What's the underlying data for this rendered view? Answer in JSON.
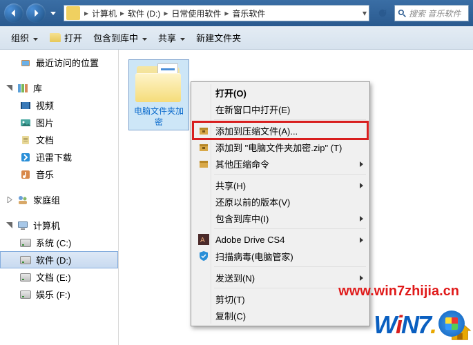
{
  "breadcrumb": [
    "计算机",
    "软件 (D:)",
    "日常使用软件",
    "音乐软件"
  ],
  "search": {
    "placeholder": "搜索 音乐软件"
  },
  "toolbar": {
    "organize": "组织",
    "open": "打开",
    "include": "包含到库中",
    "share": "共享",
    "newfolder": "新建文件夹"
  },
  "sidebar": {
    "recent": "最近访问的位置",
    "libraries": "库",
    "videos": "视频",
    "pictures": "图片",
    "documents": "文档",
    "xunlei": "迅雷下载",
    "music": "音乐",
    "homegroup": "家庭组",
    "computer": "计算机",
    "drive_c": "系统 (C:)",
    "drive_d": "软件 (D:)",
    "drive_e": "文档 (E:)",
    "drive_f": "娱乐 (F:)"
  },
  "content": {
    "folder1": "电脑文件夹加密"
  },
  "context_menu": {
    "open": "打开(O)",
    "open_new": "在新窗口中打开(E)",
    "add_archive": "添加到压缩文件(A)...",
    "add_to_zip": "添加到 \"电脑文件夹加密.zip\" (T)",
    "other_zip": "其他压缩命令",
    "share": "共享(H)",
    "restore": "还原以前的版本(V)",
    "include_lib": "包含到库中(I)",
    "adobe": "Adobe Drive CS4",
    "scan": "扫描病毒(电脑管家)",
    "sendto": "发送到(N)",
    "cut": "剪切(T)",
    "copy": "复制(C)"
  },
  "watermark": {
    "url": "www.win7zhijia.cn",
    "logo_pre": "W",
    "logo_i": "i",
    "logo_post": "N7",
    "logo_dot": "."
  }
}
